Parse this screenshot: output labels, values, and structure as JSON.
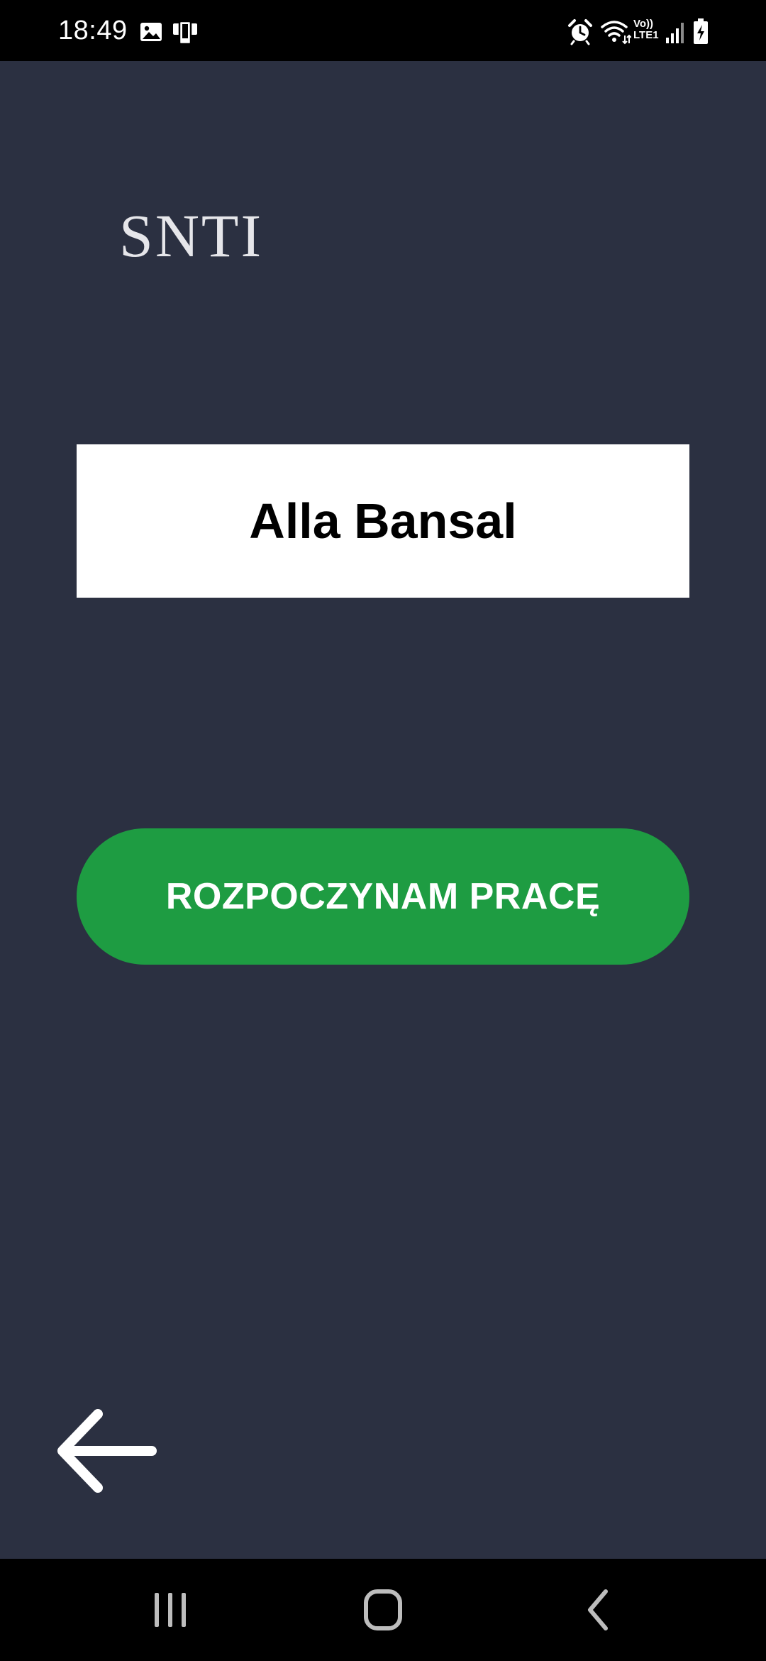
{
  "status_bar": {
    "time": "18:49",
    "left_icons": [
      "gallery-icon",
      "phone-screen-icon"
    ],
    "right_icons": [
      "alarm-icon",
      "wifi-icon",
      "volte-icon",
      "signal-icon",
      "battery-charging-icon"
    ],
    "volte_top": "Vo))",
    "volte_bottom": "LTE1"
  },
  "logo": {
    "text": "SNTI"
  },
  "employee": {
    "name": "Alla Bansal"
  },
  "actions": {
    "start_label": "ROZPOCZYNAM PRACĘ"
  },
  "navigation": {
    "back_icon": "arrow-left-icon",
    "system_buttons": [
      "recent-apps-icon",
      "home-icon",
      "back-chevron-icon"
    ]
  },
  "colors": {
    "background": "#2b3041",
    "status_bar": "#000000",
    "name_box": "#ffffff",
    "start_button": "#1e9c42",
    "text_light": "#ffffff",
    "text_dark": "#000000"
  }
}
